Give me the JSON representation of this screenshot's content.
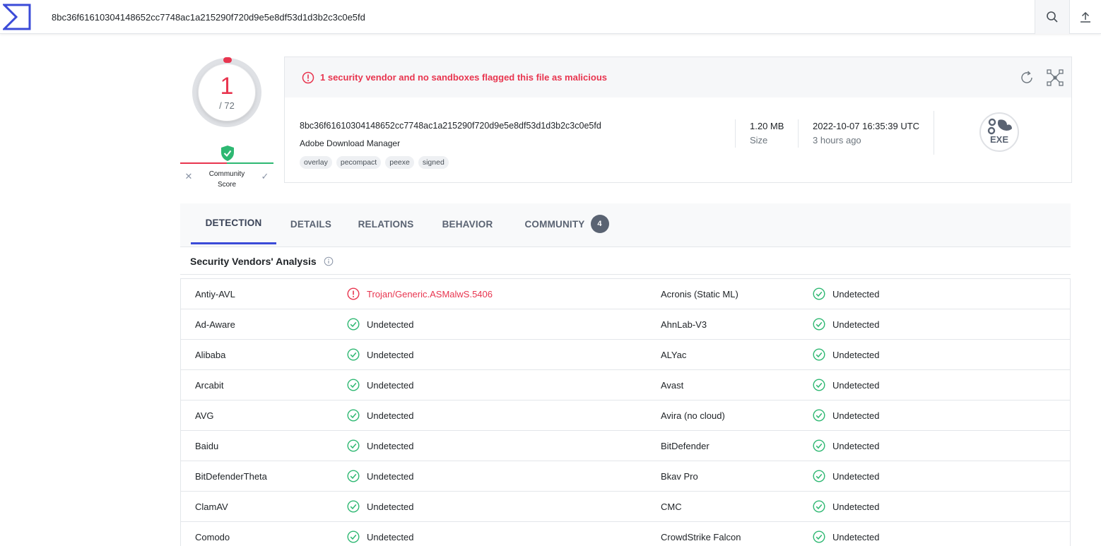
{
  "search": {
    "value": "8bc36f61610304148652cc7748ac1a215290f720d9e5e8df53d1d3b2c3c0e5fd"
  },
  "score": {
    "detections": "1",
    "total": "/ 72",
    "color_malicious": "#e8354f",
    "color_clean": "#2eb872"
  },
  "community": {
    "label_line1": "Community",
    "label_line2": "Score"
  },
  "alert": {
    "text": "1 security vendor and no sandboxes flagged this file as malicious"
  },
  "file": {
    "hash": "8bc36f61610304148652cc7748ac1a215290f720d9e5e8df53d1d3b2c3c0e5fd",
    "name": "Adobe Download Manager",
    "tags": [
      "overlay",
      "pecompact",
      "peexe",
      "signed"
    ],
    "size_value": "1.20 MB",
    "size_label": "Size",
    "date_value": "2022-10-07 16:35:39 UTC",
    "date_relative": "3 hours ago",
    "type_icon_label": "EXE"
  },
  "tabs": [
    {
      "label": "DETECTION",
      "active": true
    },
    {
      "label": "DETAILS"
    },
    {
      "label": "RELATIONS"
    },
    {
      "label": "BEHAVIOR"
    },
    {
      "label": "COMMUNITY",
      "badge": "4"
    }
  ],
  "section": {
    "title": "Security Vendors' Analysis"
  },
  "vendors": [
    [
      {
        "name": "Antiy-AVL",
        "result": "Trojan/Generic.ASMalwS.5406",
        "malicious": true
      },
      {
        "name": "Acronis (Static ML)",
        "result": "Undetected"
      }
    ],
    [
      {
        "name": "Ad-Aware",
        "result": "Undetected"
      },
      {
        "name": "AhnLab-V3",
        "result": "Undetected"
      }
    ],
    [
      {
        "name": "Alibaba",
        "result": "Undetected"
      },
      {
        "name": "ALYac",
        "result": "Undetected"
      }
    ],
    [
      {
        "name": "Arcabit",
        "result": "Undetected"
      },
      {
        "name": "Avast",
        "result": "Undetected"
      }
    ],
    [
      {
        "name": "AVG",
        "result": "Undetected"
      },
      {
        "name": "Avira (no cloud)",
        "result": "Undetected"
      }
    ],
    [
      {
        "name": "Baidu",
        "result": "Undetected"
      },
      {
        "name": "BitDefender",
        "result": "Undetected"
      }
    ],
    [
      {
        "name": "BitDefenderTheta",
        "result": "Undetected"
      },
      {
        "name": "Bkav Pro",
        "result": "Undetected"
      }
    ],
    [
      {
        "name": "ClamAV",
        "result": "Undetected"
      },
      {
        "name": "CMC",
        "result": "Undetected"
      }
    ],
    [
      {
        "name": "Comodo",
        "result": "Undetected"
      },
      {
        "name": "CrowdStrike Falcon",
        "result": "Undetected"
      }
    ]
  ],
  "icons": {
    "logo": "virustotal-logo",
    "search": "search-icon",
    "upload": "upload-icon",
    "alert": "alert-circle-icon",
    "reanalyze": "refresh-icon",
    "graph": "graph-icon",
    "clean": "check-circle-icon",
    "malicious": "alert-circle-icon",
    "info": "info-icon"
  }
}
